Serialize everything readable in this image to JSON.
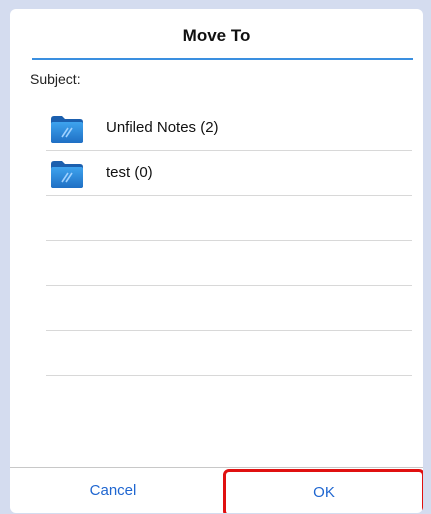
{
  "dialog": {
    "title": "Move To",
    "subject_label": "Subject:",
    "folders": [
      {
        "label": "Unfiled Notes (2)",
        "icon": "folder-icon"
      },
      {
        "label": "test (0)",
        "icon": "folder-icon"
      }
    ],
    "cancel_label": "Cancel",
    "ok_label": "OK"
  },
  "colors": {
    "accent": "#3a8fe0",
    "button_text": "#1f66d0",
    "highlight": "#e01010",
    "backdrop": "#d4dcef"
  }
}
